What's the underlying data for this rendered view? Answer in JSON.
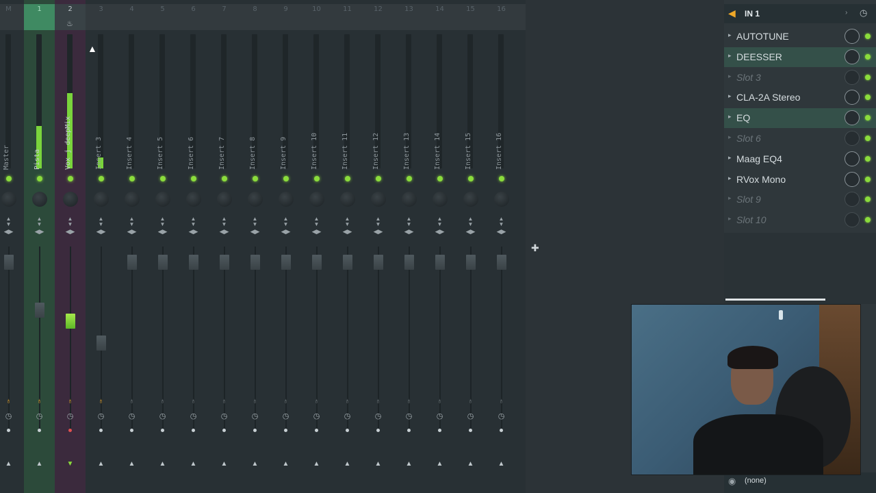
{
  "mixer": {
    "strips": [
      {
        "num": "M",
        "name": "Master",
        "kind": "master"
      },
      {
        "num": "1",
        "name": "Pista",
        "kind": "pista"
      },
      {
        "num": "2",
        "name": "Vox j deepMix",
        "kind": "vox"
      },
      {
        "num": "3",
        "name": "Insert 3",
        "kind": "normal"
      },
      {
        "num": "4",
        "name": "Insert 4",
        "kind": "normal"
      },
      {
        "num": "5",
        "name": "Insert 5",
        "kind": "normal"
      },
      {
        "num": "6",
        "name": "Insert 6",
        "kind": "normal"
      },
      {
        "num": "7",
        "name": "Insert 7",
        "kind": "normal"
      },
      {
        "num": "8",
        "name": "Insert 8",
        "kind": "normal"
      },
      {
        "num": "9",
        "name": "Insert 9",
        "kind": "normal"
      },
      {
        "num": "10",
        "name": "Insert 10",
        "kind": "normal"
      },
      {
        "num": "11",
        "name": "Insert 11",
        "kind": "normal"
      },
      {
        "num": "12",
        "name": "Insert 12",
        "kind": "normal"
      },
      {
        "num": "13",
        "name": "Insert 13",
        "kind": "normal"
      },
      {
        "num": "14",
        "name": "Insert 14",
        "kind": "normal"
      },
      {
        "num": "15",
        "name": "Insert 15",
        "kind": "normal"
      },
      {
        "num": "16",
        "name": "Insert 16",
        "kind": "normal"
      }
    ]
  },
  "panel": {
    "input": "IN 1",
    "output": "(none)",
    "slots": [
      {
        "label": "AUTOTUNE",
        "empty": false,
        "highlight": false
      },
      {
        "label": "DEESSER",
        "empty": false,
        "highlight": true
      },
      {
        "label": "Slot 3",
        "empty": true,
        "highlight": false
      },
      {
        "label": "CLA-2A Stereo",
        "empty": false,
        "highlight": false
      },
      {
        "label": "EQ",
        "empty": false,
        "highlight": true
      },
      {
        "label": "Slot 6",
        "empty": true,
        "highlight": false
      },
      {
        "label": "Maag EQ4",
        "empty": false,
        "highlight": false
      },
      {
        "label": "RVox Mono",
        "empty": false,
        "highlight": false
      },
      {
        "label": "Slot 9",
        "empty": true,
        "highlight": false
      },
      {
        "label": "Slot 10",
        "empty": true,
        "highlight": false
      }
    ]
  },
  "colors": {
    "accent_green": "#8bdc3c",
    "pista_bg": "#2c4a3a",
    "vox_bg": "#3b2a3d",
    "ext_orange": "#f0a828"
  },
  "icons": {
    "ext": "speaker-icon",
    "clock": "clock-icon",
    "fire": "fire-icon"
  }
}
